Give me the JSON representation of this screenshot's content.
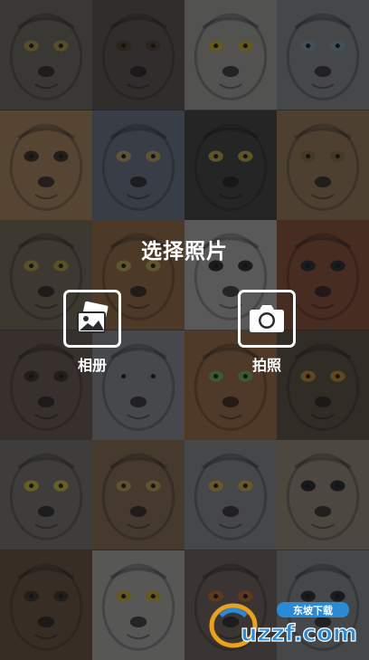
{
  "page": {
    "title": "选择照片"
  },
  "actions": {
    "album": {
      "label": "相册",
      "icon": "photo-album-icon"
    },
    "camera": {
      "label": "拍照",
      "icon": "camera-icon"
    }
  },
  "background_tiles": [
    {
      "name": "tiger",
      "fur": "#6f6656",
      "eye": "#b89a3a"
    },
    {
      "name": "monkey",
      "fur": "#5a4e44",
      "eye": "#4a3a22"
    },
    {
      "name": "owl",
      "fur": "#a8a59c",
      "eye": "#d6b21e"
    },
    {
      "name": "white-tiger",
      "fur": "#8a8a88",
      "eye": "#7ea3b5"
    },
    {
      "name": "dog",
      "fur": "#b08555",
      "eye": "#3b2a18"
    },
    {
      "name": "wolf",
      "fur": "#6a7480",
      "eye": "#c7a95a"
    },
    {
      "name": "panther",
      "fur": "#3c3a36",
      "eye": "#c9a63a"
    },
    {
      "name": "lion",
      "fur": "#9c7a4c",
      "eye": "#8a6a30"
    },
    {
      "name": "cat",
      "fur": "#76664e",
      "eye": "#b8a03a"
    },
    {
      "name": "tiger-face",
      "fur": "#9a6a38",
      "eye": "#c8b04a"
    },
    {
      "name": "polar-bear",
      "fur": "#b8b6b0",
      "eye": "#222222"
    },
    {
      "name": "red-panda",
      "fur": "#8a4a2a",
      "eye": "#222222"
    },
    {
      "name": "chimpanzee",
      "fur": "#6a5444",
      "eye": "#3a2a1a"
    },
    {
      "name": "white-wolf",
      "fur": "#8e8e8e",
      "eye": "#8a8a8a"
    },
    {
      "name": "tiger-close",
      "fur": "#a06a3a",
      "eye": "#7bb24a"
    },
    {
      "name": "eagle-owl",
      "fur": "#5c4a38",
      "eye": "#d08a1e"
    },
    {
      "name": "owl-beak",
      "fur": "#7a7468",
      "eye": "#d9c22a"
    },
    {
      "name": "roaring-lion",
      "fur": "#8a6a48",
      "eye": "#c9a54a"
    },
    {
      "name": "eagle",
      "fur": "#8a8a86",
      "eye": "#d9b23a"
    },
    {
      "name": "pug",
      "fur": "#9a8a70",
      "eye": "#1e1e1e"
    },
    {
      "name": "chimp",
      "fur": "#6a4e32",
      "eye": "#3a2a1a"
    },
    {
      "name": "snowy-owl",
      "fur": "#b2b0a8",
      "eye": "#d6b41e"
    },
    {
      "name": "lemur",
      "fur": "#6e5e54",
      "eye": "#c66a1e"
    },
    {
      "name": "raccoon",
      "fur": "#8a8a88",
      "eye": "#222222"
    }
  ],
  "watermark": {
    "brand": "uzzf.com",
    "tag": "东坡下载"
  }
}
